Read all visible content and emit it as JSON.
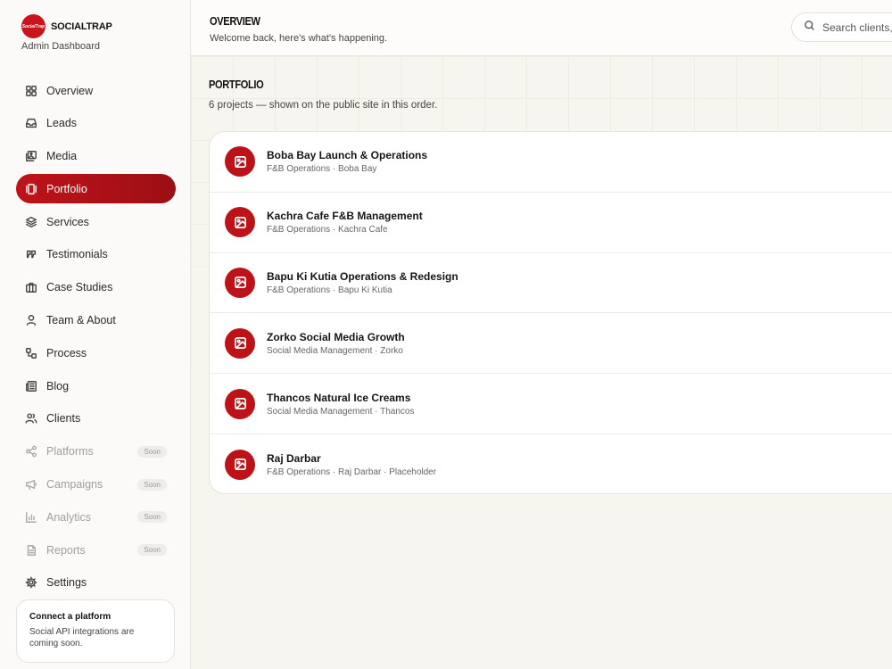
{
  "brand": {
    "name": "SOCIALTRAP",
    "logo_text": "SocialTrap",
    "subtitle": "Admin Dashboard"
  },
  "nav": {
    "items": [
      {
        "label": "Overview",
        "icon": "grid-icon"
      },
      {
        "label": "Leads",
        "icon": "inbox-icon"
      },
      {
        "label": "Media",
        "icon": "images-icon"
      },
      {
        "label": "Portfolio",
        "icon": "gallery-icon",
        "active": true
      },
      {
        "label": "Services",
        "icon": "layers-icon"
      },
      {
        "label": "Testimonials",
        "icon": "quote-icon"
      },
      {
        "label": "Case Studies",
        "icon": "briefcase-icon"
      },
      {
        "label": "Team & About",
        "icon": "user-icon"
      },
      {
        "label": "Process",
        "icon": "workflow-icon"
      },
      {
        "label": "Blog",
        "icon": "newspaper-icon"
      },
      {
        "label": "Clients",
        "icon": "users-icon"
      },
      {
        "label": "Platforms",
        "icon": "share-icon",
        "badge": "Soon"
      },
      {
        "label": "Campaigns",
        "icon": "megaphone-icon",
        "badge": "Soon"
      },
      {
        "label": "Analytics",
        "icon": "bar-chart-icon",
        "badge": "Soon"
      },
      {
        "label": "Reports",
        "icon": "file-icon",
        "badge": "Soon"
      },
      {
        "label": "Settings",
        "icon": "gear-icon"
      }
    ]
  },
  "connect_card": {
    "title": "Connect a platform",
    "text": "Social API integrations are coming soon."
  },
  "header": {
    "title": "OVERVIEW",
    "subtitle": "Welcome back, here's what's happening.",
    "search_placeholder": "Search clients, l"
  },
  "portfolio": {
    "title": "PORTFOLIO",
    "subtitle": "6 projects — shown on the public site in this order.",
    "projects": [
      {
        "title": "Boba Bay Launch & Operations",
        "meta": "F&B Operations · Boba Bay"
      },
      {
        "title": "Kachra Cafe F&B Management",
        "meta": "F&B Operations · Kachra Cafe"
      },
      {
        "title": "Bapu Ki Kutia Operations & Redesign",
        "meta": "F&B Operations · Bapu Ki Kutia"
      },
      {
        "title": "Zorko Social Media Growth",
        "meta": "Social Media Management · Zorko"
      },
      {
        "title": "Thancos Natural Ice Creams",
        "meta": "Social Media Management · Thancos"
      },
      {
        "title": "Raj Darbar",
        "meta": "F&B Operations · Raj Darbar · Placeholder"
      }
    ]
  },
  "colors": {
    "accent": "#c0121a",
    "background": "#f7f5ef"
  }
}
